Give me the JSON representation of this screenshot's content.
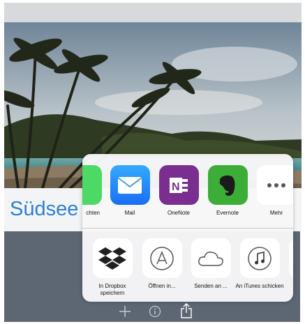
{
  "document": {
    "title": "Südsee"
  },
  "share_sheet": {
    "apps": [
      {
        "label": "chten",
        "icon": "messages-icon",
        "color": "#4cd964"
      },
      {
        "label": "Mail",
        "icon": "mail-icon",
        "color": "#1a82fb"
      },
      {
        "label": "OneNote",
        "icon": "onenote-icon",
        "color": "#7a2e8f"
      },
      {
        "label": "Evernote",
        "icon": "evernote-icon",
        "color": "#3cae38"
      },
      {
        "label": "Mehr",
        "icon": "more-icon",
        "color": "#ffffff"
      }
    ],
    "actions": [
      {
        "label": "In Dropbox speichern",
        "icon": "dropbox-icon"
      },
      {
        "label": "Öffnen in...",
        "icon": "app-store-icon"
      },
      {
        "label": "Senden an ...",
        "icon": "cloud-icon"
      },
      {
        "label": "An iTunes schicken",
        "icon": "itunes-icon"
      }
    ]
  },
  "toolbar": {
    "buttons": [
      "add-icon",
      "info-icon",
      "share-icon"
    ]
  }
}
